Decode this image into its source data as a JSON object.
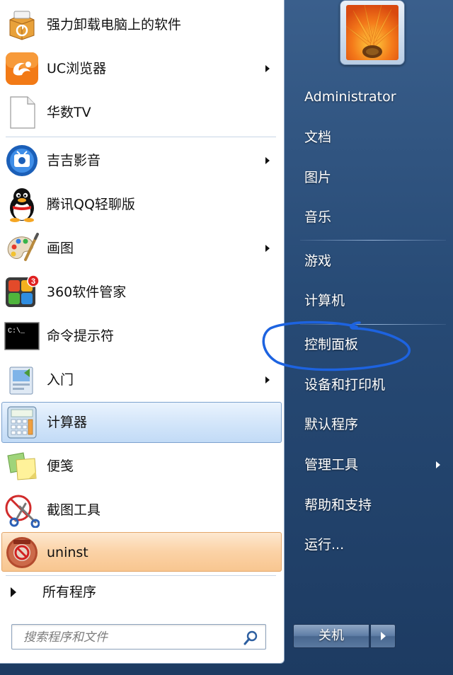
{
  "left_pane": {
    "programs": [
      {
        "label": "强力卸载电脑上的软件",
        "icon": "recycle-box-icon",
        "has_submenu": false
      },
      {
        "label": "UC浏览器",
        "icon": "uc-browser-icon",
        "has_submenu": true
      },
      {
        "label": "华数TV",
        "icon": "blank-document-icon",
        "has_submenu": false
      },
      {
        "label": "吉吉影音",
        "icon": "jijiyingyin-icon",
        "has_submenu": true
      },
      {
        "label": "腾讯QQ轻聊版",
        "icon": "qq-penguin-icon",
        "has_submenu": false
      },
      {
        "label": "画图",
        "icon": "paint-palette-icon",
        "has_submenu": true
      },
      {
        "label": "360软件管家",
        "icon": "360-software-manager-icon",
        "has_submenu": false,
        "badge": "3"
      },
      {
        "label": "命令提示符",
        "icon": "command-prompt-icon",
        "has_submenu": false,
        "prompt_text": "C:\\_"
      },
      {
        "label": "入门",
        "icon": "getting-started-icon",
        "has_submenu": true
      },
      {
        "label": "计算器",
        "icon": "calculator-icon",
        "has_submenu": false,
        "highlight": "blue"
      },
      {
        "label": "便笺",
        "icon": "sticky-notes-icon",
        "has_submenu": false
      },
      {
        "label": "截图工具",
        "icon": "snipping-tool-icon",
        "has_submenu": false
      },
      {
        "label": "uninst",
        "icon": "uninstall-disc-icon",
        "has_submenu": false,
        "highlight": "orange"
      }
    ],
    "all_programs_label": "所有程序",
    "search_placeholder": "搜索程序和文件"
  },
  "right_pane": {
    "user_picture_icon": "flower-avatar-icon",
    "items": [
      {
        "label": "Administrator",
        "has_submenu": false
      },
      {
        "label": "文档",
        "has_submenu": false
      },
      {
        "label": "图片",
        "has_submenu": false
      },
      {
        "label": "音乐",
        "has_submenu": false
      },
      {
        "label": "游戏",
        "has_submenu": false
      },
      {
        "label": "计算机",
        "has_submenu": false
      },
      {
        "label": "控制面板",
        "has_submenu": false,
        "annotated": true
      },
      {
        "label": "设备和打印机",
        "has_submenu": false
      },
      {
        "label": "默认程序",
        "has_submenu": false
      },
      {
        "label": "管理工具",
        "has_submenu": true
      },
      {
        "label": "帮助和支持",
        "has_submenu": false
      },
      {
        "label": "运行...",
        "has_submenu": false
      }
    ],
    "shutdown_label": "关机",
    "annotation_color": "#1d63e0"
  },
  "colors": {
    "menu_blue": "#274a75",
    "highlight_blue": "#d4e6fa",
    "highlight_orange": "#fbd2a6"
  }
}
